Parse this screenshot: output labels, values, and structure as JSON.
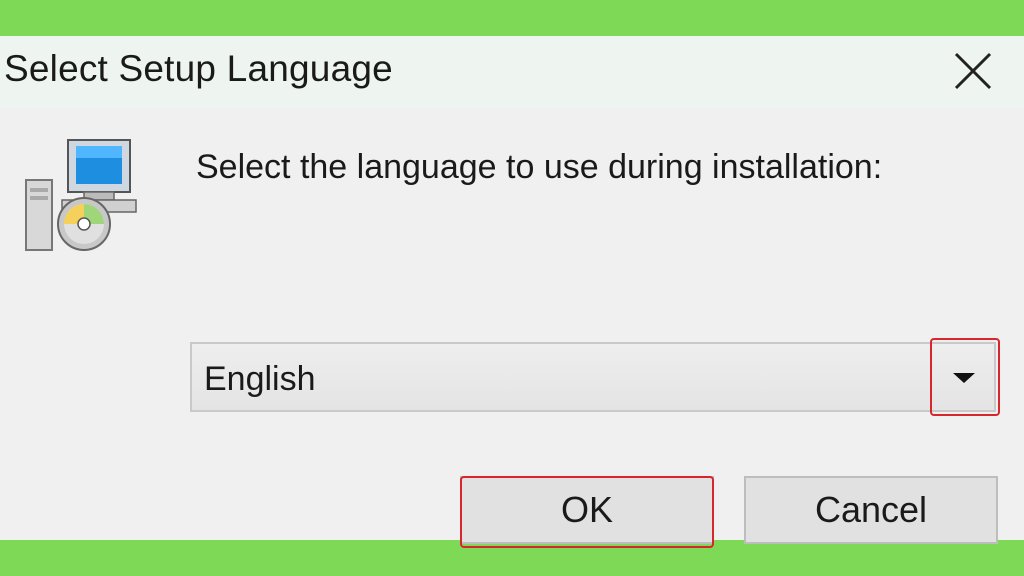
{
  "window": {
    "title": "Select Setup Language",
    "close_icon": "close-icon"
  },
  "dialog": {
    "icon": "setup-installer-icon",
    "prompt": "Select the language to use during installation:",
    "language_select": {
      "value": "English",
      "arrow_icon": "dropdown-arrow-icon"
    },
    "buttons": {
      "ok_label": "OK",
      "cancel_label": "Cancel"
    }
  },
  "colors": {
    "background": "#7ed957",
    "dialog_bg": "#f0f0f0",
    "titlebar_bg": "#eef5f0",
    "highlight": "#d8262e"
  }
}
